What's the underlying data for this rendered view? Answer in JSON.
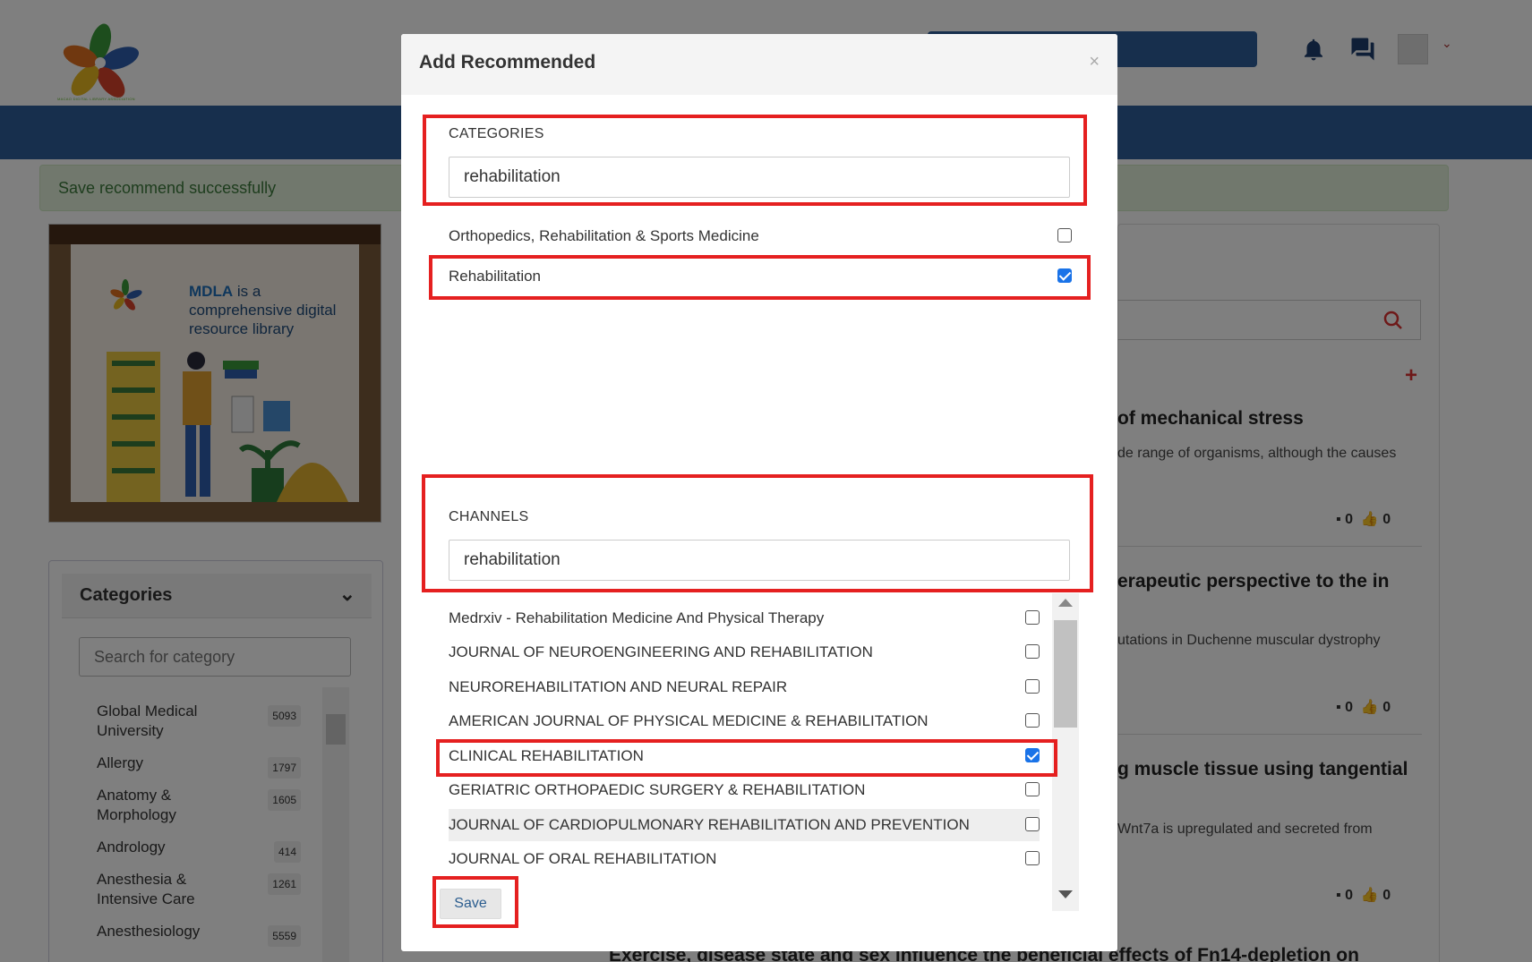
{
  "alert": {
    "text": "Save recommend successfully"
  },
  "banner": {
    "brand": "MDLA",
    "tagline_1": " is a",
    "tagline_2": "comprehensive digital",
    "tagline_3": "resource library",
    "logo_text": "MACAO DIGITAL LIBRARY ASSOCIATION"
  },
  "categories_panel": {
    "title": "Categories",
    "search_placeholder": "Search for category",
    "items": [
      {
        "label": "Global Medical University",
        "count": "5093"
      },
      {
        "label": "Allergy",
        "count": "1797"
      },
      {
        "label": "Anatomy & Morphology",
        "count": "1605"
      },
      {
        "label": "Andrology",
        "count": "414"
      },
      {
        "label": "Anesthesia & Intensive Care",
        "count": "1261"
      },
      {
        "label": "Anesthesiology",
        "count": "5559"
      }
    ]
  },
  "right_panel": {
    "articles": [
      {
        "title": "of mechanical stress",
        "snippet": "de range of organisms, although the causes",
        "comments": "0",
        "likes": "0"
      },
      {
        "title": "erapeutic perspective to the in",
        "snippet": "utations in Duchenne muscular dystrophy",
        "comments": "0",
        "likes": "0"
      },
      {
        "title": "g muscle tissue using tangential",
        "snippet": "Wnt7a is upregulated and secreted from",
        "comments": "0",
        "likes": "0"
      }
    ],
    "bottom_title": "Exercise, disease state and sex influence the beneficial effects of Fn14-depletion on"
  },
  "modal": {
    "title": "Add Recommended",
    "close": "×",
    "categories": {
      "label": "CATEGORIES",
      "value": "rehabilitation",
      "options": [
        {
          "label": "Orthopedics, Rehabilitation & Sports Medicine",
          "checked": false
        },
        {
          "label": "Rehabilitation",
          "checked": true
        }
      ]
    },
    "channels": {
      "label": "CHANNELS",
      "value": "rehabilitation",
      "options": [
        {
          "label": "Medrxiv - Rehabilitation Medicine And Physical Therapy",
          "checked": false
        },
        {
          "label": "JOURNAL OF NEUROENGINEERING AND REHABILITATION",
          "checked": false
        },
        {
          "label": "NEUROREHABILITATION AND NEURAL REPAIR",
          "checked": false
        },
        {
          "label": "AMERICAN JOURNAL OF PHYSICAL MEDICINE & REHABILITATION",
          "checked": false
        },
        {
          "label": "CLINICAL REHABILITATION",
          "checked": true
        },
        {
          "label": "GERIATRIC ORTHOPAEDIC SURGERY & REHABILITATION",
          "checked": false
        },
        {
          "label": "JOURNAL OF CARDIOPULMONARY REHABILITATION AND PREVENTION",
          "checked": false
        },
        {
          "label": "JOURNAL OF ORAL REHABILITATION",
          "checked": false
        }
      ]
    },
    "save_label": "Save"
  },
  "colors": {
    "brand_blue": "#2e5f9a",
    "checkbox_blue": "#1a73e8",
    "annotation_red": "#e52020"
  }
}
